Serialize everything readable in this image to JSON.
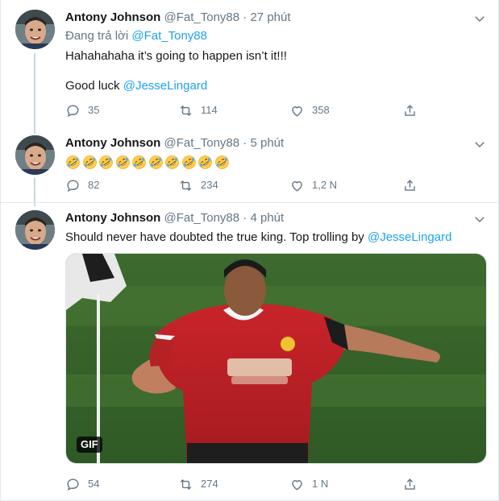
{
  "tweets": [
    {
      "name": "Antony Johnson",
      "handle": "@Fat_Tony88",
      "sep": "·",
      "time": "27 phút",
      "reply_prefix": "Đang trả lời",
      "reply_handle": "@Fat_Tony88",
      "line1": "Hahahahaha it’s going to happen isn’t it!!!",
      "line2_prefix": "Good luck",
      "line2_mention": "@JesseLingard",
      "replies": "35",
      "retweets": "114",
      "likes": "358"
    },
    {
      "name": "Antony Johnson",
      "handle": "@Fat_Tony88",
      "sep": "·",
      "time": "5 phút",
      "emoji_count": 10,
      "emoji_name": "rolling-on-floor-laughing-emoji",
      "replies": "82",
      "retweets": "234",
      "likes": "1,2 N"
    },
    {
      "name": "Antony Johnson",
      "handle": "@Fat_Tony88",
      "sep": "·",
      "time": "4 phút",
      "text_prefix": "Should never have doubted the true king.  Top trolling by",
      "text_mention": "@JesseLingard",
      "gif_label": "GIF",
      "replies": "54",
      "retweets": "274",
      "likes": "1 N"
    }
  ],
  "icons": {
    "reply": "reply-icon",
    "retweet": "retweet-icon",
    "like": "heart-icon",
    "share": "share-icon",
    "more": "chevron-down-icon"
  },
  "colors": {
    "link": "#1da1f2",
    "muted": "#657786",
    "thread": "#ccd6dd"
  }
}
